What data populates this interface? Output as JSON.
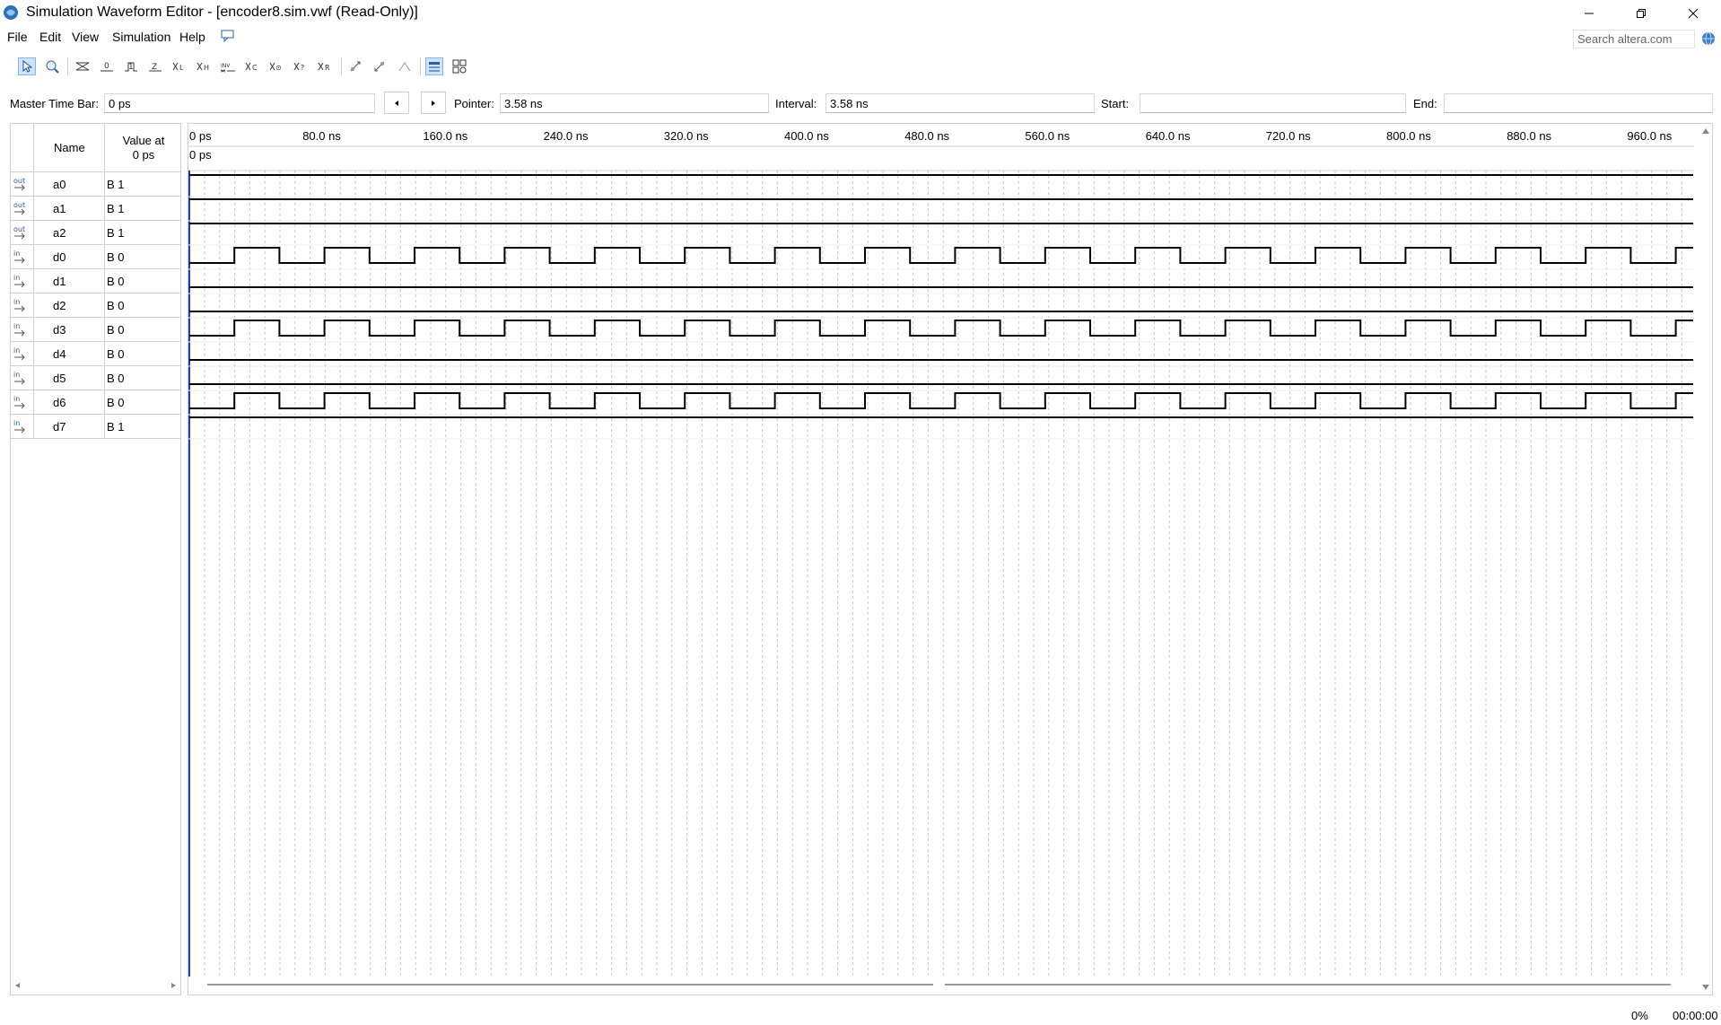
{
  "window": {
    "title": "Simulation Waveform Editor - [encoder8.sim.vwf (Read-Only)]",
    "minimize_icon": "minimize-icon",
    "restore_icon": "restore-icon",
    "close_icon": "close-icon"
  },
  "menu": {
    "items": [
      "File",
      "Edit",
      "View",
      "Simulation",
      "Help"
    ],
    "search_placeholder": "Search altera.com"
  },
  "timebar": {
    "master_label": "Master Time Bar:",
    "master_value": "0 ps",
    "pointer_label": "Pointer:",
    "pointer_value": "3.58 ns",
    "interval_label": "Interval:",
    "interval_value": "3.58 ns",
    "start_label": "Start:",
    "start_value": "",
    "end_label": "End:",
    "end_value": ""
  },
  "table": {
    "header_name": "Name",
    "header_value_line1": "Value at",
    "header_value_line2": "0 ps"
  },
  "signals": [
    {
      "type": "out",
      "name": "a0",
      "value": "B 1",
      "wave": "high"
    },
    {
      "type": "out",
      "name": "a1",
      "value": "B 1",
      "wave": "high"
    },
    {
      "type": "out",
      "name": "a2",
      "value": "B 1",
      "wave": "high"
    },
    {
      "type": "in",
      "name": "d0",
      "value": "B 0",
      "wave": "clock"
    },
    {
      "type": "in",
      "name": "d1",
      "value": "B 0",
      "wave": "low"
    },
    {
      "type": "in",
      "name": "d2",
      "value": "B 0",
      "wave": "low"
    },
    {
      "type": "in",
      "name": "d3",
      "value": "B 0",
      "wave": "clock"
    },
    {
      "type": "in",
      "name": "d4",
      "value": "B 0",
      "wave": "low"
    },
    {
      "type": "in",
      "name": "d5",
      "value": "B 0",
      "wave": "low"
    },
    {
      "type": "in",
      "name": "d6",
      "value": "B 0",
      "wave": "clock"
    },
    {
      "type": "in",
      "name": "d7",
      "value": "B 1",
      "wave": "high"
    }
  ],
  "ruler": {
    "labels": [
      "0 ps",
      "80.0 ns",
      "160.0 ns",
      "240.0 ns",
      "320.0 ns",
      "400.0 ns",
      "480.0 ns",
      "560.0 ns",
      "640.0 ns",
      "720.0 ns",
      "800.0 ns",
      "880.0 ns",
      "960.0 ns"
    ],
    "cursor_label": "0 ps"
  },
  "status": {
    "progress": "0%",
    "elapsed": "00:00:00"
  }
}
